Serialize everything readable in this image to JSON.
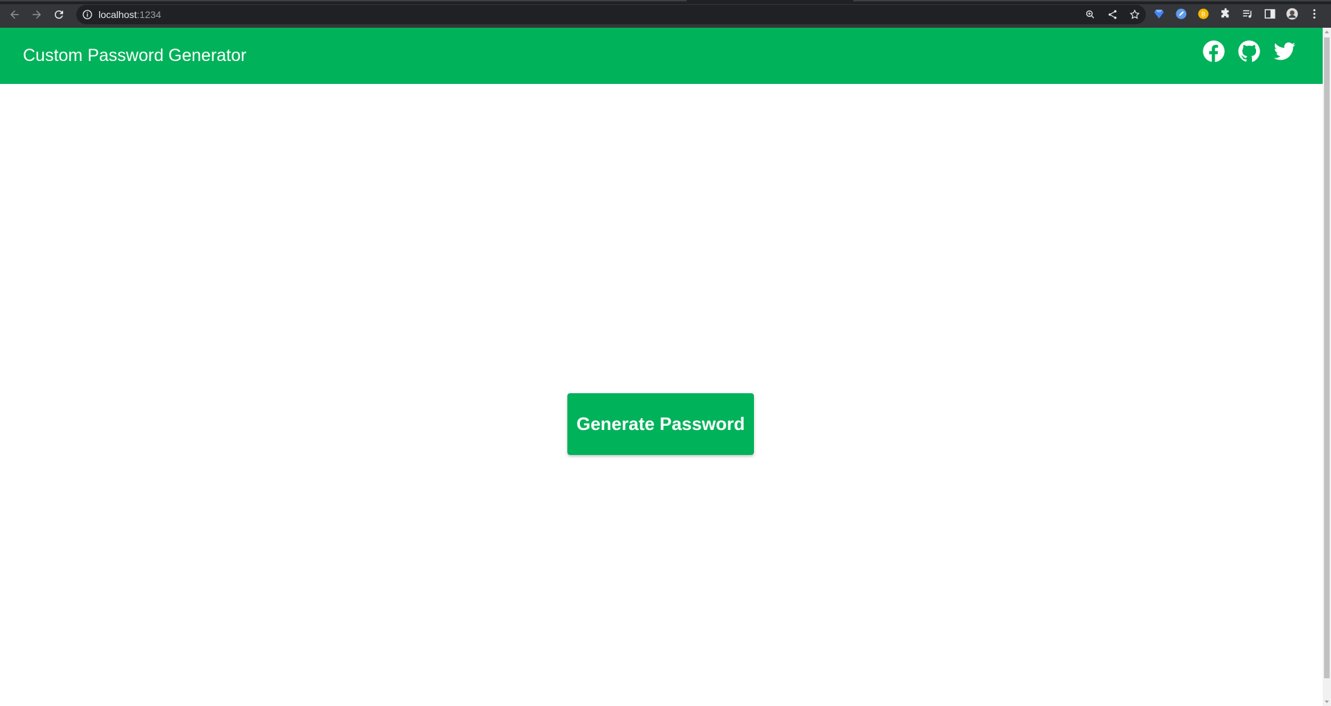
{
  "browser": {
    "url_host": "localhost",
    "url_port": ":1234",
    "chrome_color": "#35363a",
    "omnibox_color": "#202124"
  },
  "app": {
    "title": "Custom Password Generator",
    "header_color": "#00b259",
    "social_icons": [
      "facebook-icon",
      "github-icon",
      "twitter-icon"
    ]
  },
  "main": {
    "generate_button_label": "Generate Password",
    "button_color": "#00b259"
  }
}
